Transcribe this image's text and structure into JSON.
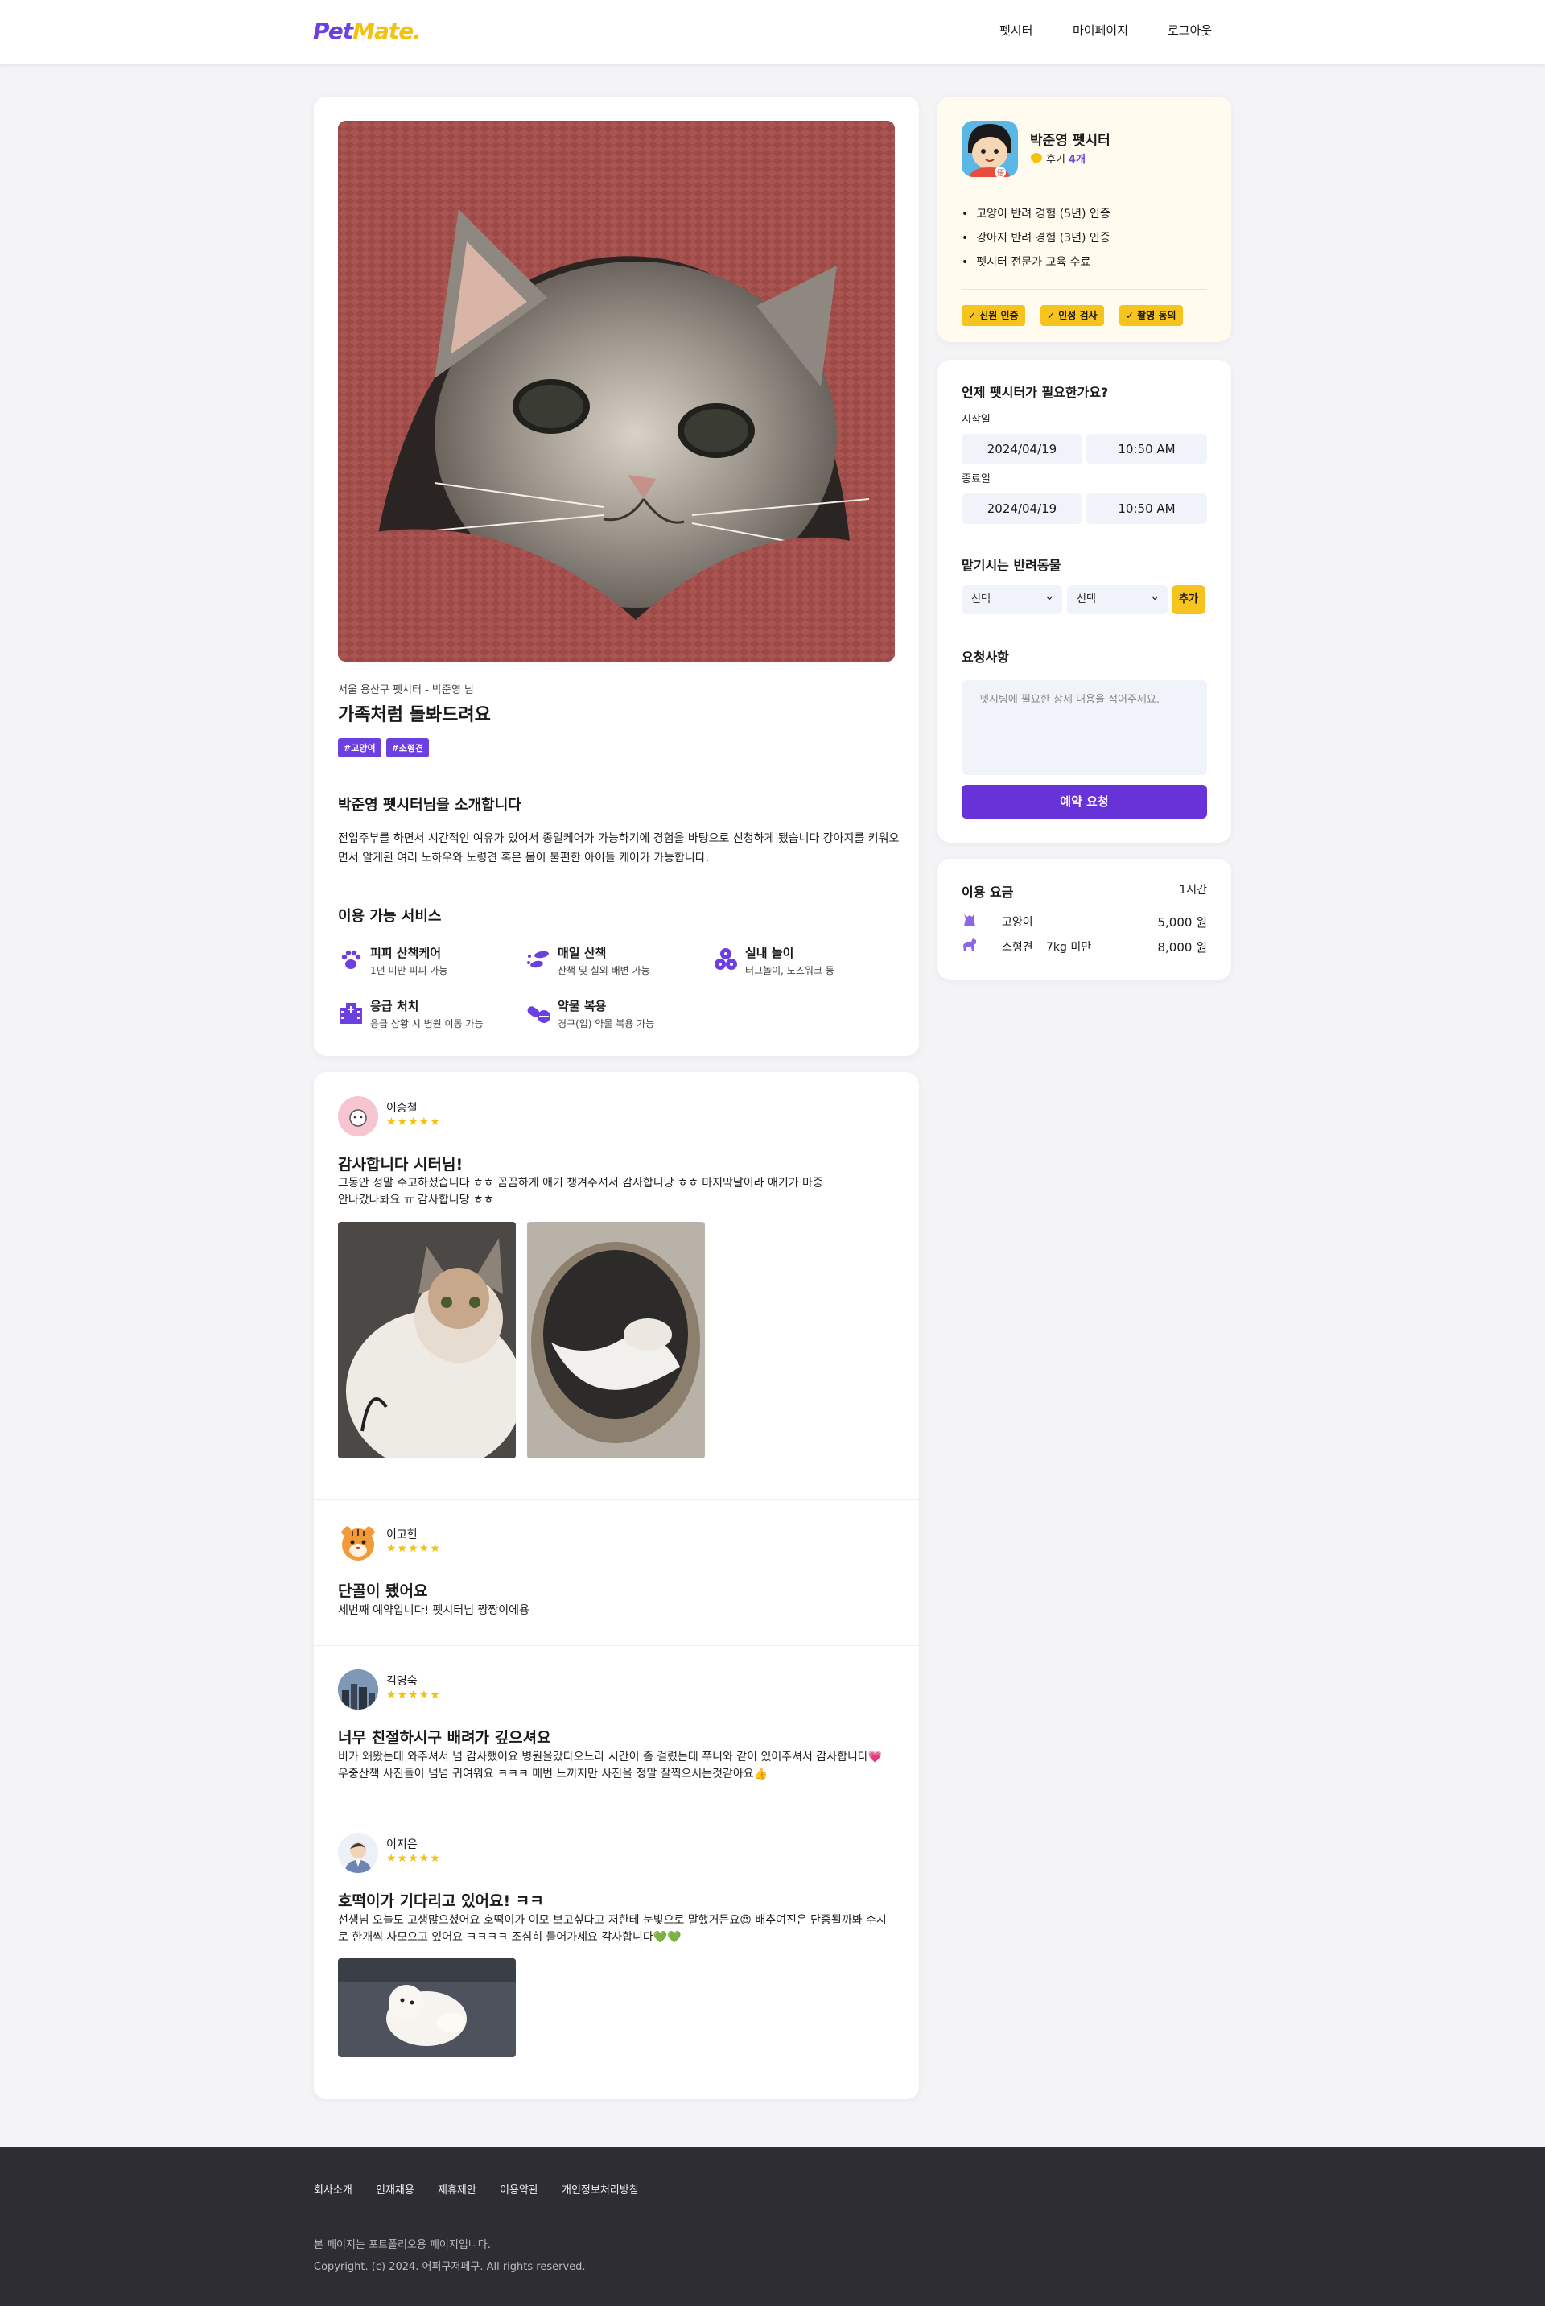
{
  "header": {
    "logo_part1": "Pet",
    "logo_part2": "Mate.",
    "nav": [
      "펫시터",
      "마이페이지",
      "로그아웃"
    ]
  },
  "listing": {
    "meta": "서울 용산구 펫시터 - 박준영 님",
    "title": "가족처럼 돌봐드려요",
    "tags": [
      "#고양이",
      "#소형견"
    ],
    "intro_title": "박준영 펫시터님을 소개합니다",
    "intro_body": "전업주부를 하면서 시간적인 여유가 있어서 종일케어가 가능하기에 경험을 바탕으로 신청하게 됐습니다 강아지를 키워오면서 알게된 여러 노하우와 노령견 혹은 몸이 불편한 아이들 케어가 가능합니다.",
    "services_title": "이용 가능 서비스",
    "services": [
      {
        "name": "피피 산책케어",
        "desc": "1년 미만 피피 가능",
        "icon": "paw-icon"
      },
      {
        "name": "매일 산책",
        "desc": "산책 및 실외 배변 가능",
        "icon": "footprints-icon"
      },
      {
        "name": "실내 놀이",
        "desc": "터그놀이, 노즈워크 등",
        "icon": "toys-icon"
      },
      {
        "name": "응급 처치",
        "desc": "응급 상황 시 병원 이동 가능",
        "icon": "hospital-icon"
      },
      {
        "name": "약물 복용",
        "desc": "경구(입) 약물 복용 가능",
        "icon": "pill-icon"
      }
    ]
  },
  "reviews": [
    {
      "name": "이승철",
      "stars": "★★★★★",
      "title": "감사합니다 시터님!",
      "body": "그동안 정말 수고하셨습니다 ㅎㅎ 꼼꼼하게 애기 챙겨주셔서 감사합니당 ㅎㅎ 마지막날이라 애기가 마중안나갔나봐요 ㅠ 감사합니당 ㅎㅎ"
    },
    {
      "name": "이고헌",
      "stars": "★★★★★",
      "title": "단골이 됐어요",
      "body": "세번째 예약입니다! 펫시터님 짱짱이에용"
    },
    {
      "name": "김영숙",
      "stars": "★★★★★",
      "title": "너무 친절하시구 배려가 깊으셔요",
      "body": "비가 왜왔는데 와주셔서 넘 감사했어요 병원을갔다오느라 시간이 좀 걸렸는데 쭈니와 같이 있어주셔서 감사합니다💗 우중산책 사진들이 넘넘 귀여워요 ㅋㅋㅋ 매번 느끼지만 사진을 정말 잘찍으시는것같아요👍"
    },
    {
      "name": "이지은",
      "stars": "★★★★★",
      "title": "호떡이가 기다리고 있어요! ㅋㅋ",
      "body": "선생님 오늘도 고생많으셨어요 호떡이가 이모 보고싶다고 저한테 눈빛으로 말했거든요😍 배추여진은 단중될까봐 수시로 한개씩 사모으고 있어요 ㅋㅋㅋㅋ 조심히 들어가세요 감사합니다💚💚"
    }
  ],
  "sitter": {
    "name": "박준영 펫시터",
    "reviews_label": "후기",
    "reviews_count": "4개",
    "bullets": [
      "고양이 반려 경험 (5년) 인증",
      "강아지 반려 경험 (3년) 인증",
      "펫시터 전문가 교육 수료"
    ],
    "badges": [
      "신원 인증",
      "인성 검사",
      "촬영 동의"
    ]
  },
  "booking": {
    "question": "언제 펫시터가 필요한가요?",
    "start_label": "시작일",
    "start_date": "2024/04/19",
    "start_time": "10:50 AM",
    "end_label": "종료일",
    "end_date": "2024/04/19",
    "end_time": "10:50 AM",
    "pets_title": "맡기시는 반려동물",
    "select1": "선택",
    "select2": "선택",
    "add_label": "추가",
    "request_title": "요청사항",
    "request_placeholder": "펫시팅에 필요한 상세 내용을 적어주세요.",
    "submit_label": "예약 요청"
  },
  "pricing": {
    "title": "이용 요금",
    "unit": "1시간",
    "rows": [
      {
        "pet": "고양이",
        "size": "",
        "price": "5,000 원"
      },
      {
        "pet": "소형견",
        "size": "7kg 미만",
        "price": "8,000 원"
      }
    ]
  },
  "footer": {
    "links": [
      "회사소개",
      "인재채용",
      "제휴제안",
      "이용약관",
      "개인정보처리방침"
    ],
    "note": "본 페이지는 포트폴리오용 페이지입니다.",
    "copyright": "Copyright. (c) 2024. 어퍼구저페구. All rights reserved."
  },
  "colors": {
    "brand_purple": "#6c3fe0",
    "brand_yellow": "#f4c20d",
    "footer_bg": "#2e2d33"
  }
}
